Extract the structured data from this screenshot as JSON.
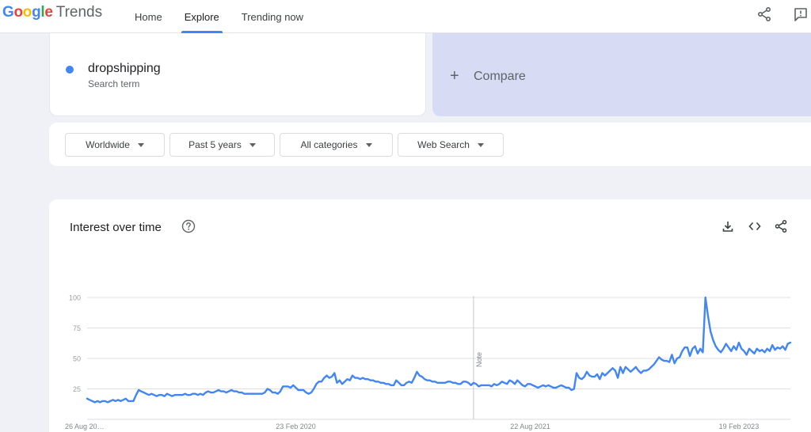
{
  "header": {
    "logo_google": "Google",
    "logo_trends": "Trends",
    "nav": [
      {
        "label": "Home",
        "active": false
      },
      {
        "label": "Explore",
        "active": true
      },
      {
        "label": "Trending now",
        "active": false
      }
    ]
  },
  "search_term": {
    "name": "dropshipping",
    "subtitle": "Search term",
    "color": "#4285f4"
  },
  "compare": {
    "label": "Compare",
    "icon": "plus-icon"
  },
  "filters": [
    {
      "label": "Worldwide"
    },
    {
      "label": "Past 5 years"
    },
    {
      "label": "All categories"
    },
    {
      "label": "Web Search"
    }
  ],
  "chart_card": {
    "title": "Interest over time",
    "icons": [
      "help-icon",
      "download-icon",
      "embed-icon",
      "share-icon"
    ]
  },
  "colors": {
    "accent": "#4285f4",
    "compare_bg": "#d7dcf4",
    "page_bg": "#eff1f7"
  },
  "chart_data": {
    "type": "line",
    "title": "",
    "xlabel": "",
    "ylabel": "",
    "ylim": [
      0,
      100
    ],
    "yticks": [
      25,
      50,
      75,
      100
    ],
    "x_tick_labels": [
      "26 Aug 20…",
      "23 Feb 2020",
      "22 Aug 2021",
      "19 Feb 2023"
    ],
    "annotation": {
      "label": "Note",
      "x_index": 150
    },
    "grid": true,
    "series": [
      {
        "name": "",
        "color": "#4285f4",
        "values": [
          17,
          16,
          15,
          14,
          15,
          14,
          15,
          15,
          14,
          15,
          16,
          15,
          16,
          15,
          16,
          17,
          15,
          15,
          15,
          20,
          24,
          23,
          22,
          21,
          20,
          21,
          20,
          19,
          20,
          20,
          19,
          21,
          20,
          19,
          20,
          20,
          20,
          20,
          21,
          20,
          20,
          21,
          21,
          20,
          21,
          20,
          22,
          23,
          22,
          22,
          23,
          24,
          23,
          23,
          22,
          23,
          24,
          23,
          23,
          22,
          22,
          21,
          21,
          21,
          21,
          21,
          21,
          21,
          21,
          22,
          25,
          24,
          22,
          22,
          21,
          23,
          27,
          27,
          27,
          26,
          28,
          26,
          24,
          24,
          24,
          22,
          21,
          22,
          25,
          29,
          31,
          31,
          34,
          36,
          34,
          35,
          38,
          30,
          32,
          29,
          31,
          33,
          32,
          36,
          34,
          34,
          33,
          34,
          33,
          33,
          32,
          32,
          31,
          31,
          30,
          30,
          29,
          29,
          28,
          28,
          32,
          30,
          28,
          28,
          30,
          31,
          30,
          34,
          39,
          36,
          35,
          33,
          32,
          32,
          31,
          31,
          30,
          30,
          30,
          30,
          31,
          31,
          30,
          30,
          29,
          29,
          31,
          31,
          30,
          28,
          30,
          29,
          27,
          28,
          28,
          28,
          28,
          27,
          29,
          28,
          29,
          31,
          30,
          29,
          32,
          31,
          29,
          32,
          30,
          28,
          27,
          29,
          29,
          28,
          27,
          26,
          27,
          28,
          27,
          28,
          27,
          26,
          26,
          27,
          28,
          27,
          26,
          26,
          24,
          25,
          38,
          34,
          33,
          35,
          39,
          36,
          35,
          35,
          37,
          33,
          38,
          36,
          38,
          40,
          42,
          40,
          34,
          43,
          38,
          43,
          41,
          39,
          41,
          43,
          40,
          38,
          40,
          40,
          41,
          43,
          45,
          48,
          51,
          49,
          48,
          48,
          47,
          53,
          46,
          50,
          51,
          56,
          59,
          59,
          52,
          58,
          60,
          54,
          58,
          55,
          100,
          85,
          72,
          65,
          60,
          57,
          55,
          58,
          62,
          59,
          56,
          60,
          57,
          63,
          58,
          56,
          53,
          58,
          56,
          54,
          58,
          56,
          57,
          55,
          58,
          56,
          61,
          57,
          59,
          58,
          60,
          57,
          62,
          63
        ]
      }
    ]
  }
}
